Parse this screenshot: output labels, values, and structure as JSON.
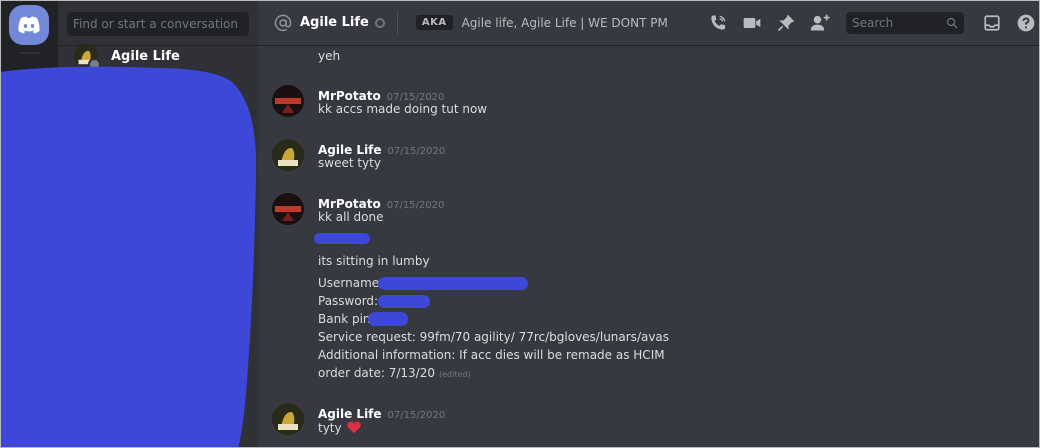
{
  "sidebar": {
    "search_placeholder": "Find or start a conversation",
    "dm": {
      "name": "Agile Life"
    }
  },
  "header": {
    "channel": "Agile Life",
    "aka_badge": "AKA",
    "aliases": "Agile life, Agile Life | WE DONT PM",
    "search_placeholder": "Search",
    "icons": [
      "phone-call-icon",
      "video-call-icon",
      "pin-icon",
      "add-friend-icon",
      "search-icon",
      "inbox-icon",
      "help-icon"
    ]
  },
  "messages": [
    {
      "lines": [
        "yeh"
      ]
    },
    {
      "author": "MrPotato",
      "date": "07/15/2020",
      "lines": [
        "kk accs made doing tut now"
      ]
    },
    {
      "author": "Agile Life",
      "date": "07/15/2020",
      "lines": [
        "sweet tyty"
      ]
    },
    {
      "author": "MrPotato",
      "date": "07/15/2020",
      "lines": [
        "kk all done",
        "its sitting in lumby",
        "Username:",
        "Password:",
        "Bank pin:",
        "Service request: 99fm/70 agility/ 77rc/bgloves/lunars/avas",
        "Additional information: If acc dies will be remade as HCIM",
        "order date: 7/13/20"
      ],
      "edited": "(edited)"
    },
    {
      "author": "Agile Life",
      "date": "07/15/2020",
      "lines": [
        "tyty"
      ],
      "emoji": "red-heart-icon"
    }
  ],
  "colors": {
    "accent": "#7289da",
    "redaction": "#3d48d8",
    "heart": "#dd2e44"
  }
}
